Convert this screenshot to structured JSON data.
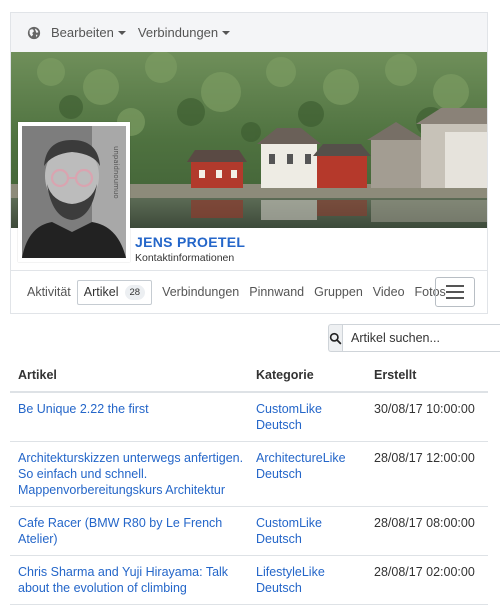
{
  "toolbar": {
    "globe_icon": "globe-icon",
    "edit_label": "Bearbeiten",
    "connections_label": "Verbindungen"
  },
  "profile": {
    "name": "JENS PROETEL",
    "contact_link": "Kontaktinformationen",
    "avatar_watermark": "unpaidnoumuo"
  },
  "tabs": {
    "activity": "Aktivität",
    "articles": "Artikel",
    "articles_count": "28",
    "connections": "Verbindungen",
    "pinboard": "Pinnwand",
    "groups": "Gruppen",
    "video": "Video",
    "photos": "Fotos",
    "menu_icon": "hamburger-icon"
  },
  "search": {
    "placeholder": "Artikel suchen...",
    "icon": "search-icon"
  },
  "table": {
    "headers": {
      "article": "Artikel",
      "category": "Kategorie",
      "created": "Erstellt"
    },
    "rows": [
      {
        "title": "Be Unique 2.22 the first",
        "category": "CustomLike Deutsch",
        "created": "30/08/17 10:00:00"
      },
      {
        "title": "Architekturskizzen unterwegs anfertigen. So einfach und schnell. Mappenvorbereitungskurs Architektur",
        "category": "ArchitectureLike Deutsch",
        "created": "28/08/17 12:00:00"
      },
      {
        "title": "Cafe Racer (BMW R80 by Le French Atelier)",
        "category": "CustomLike Deutsch",
        "created": "28/08/17 08:00:00"
      },
      {
        "title": "Chris Sharma and Yuji Hirayama: Talk about the evolution of climbing",
        "category": "LifestyleLike Deutsch",
        "created": "28/08/17 02:00:00"
      }
    ]
  },
  "colors": {
    "link": "#2466c9",
    "toolbar_bg": "#f4f5f7",
    "border": "#e1e4e8"
  }
}
